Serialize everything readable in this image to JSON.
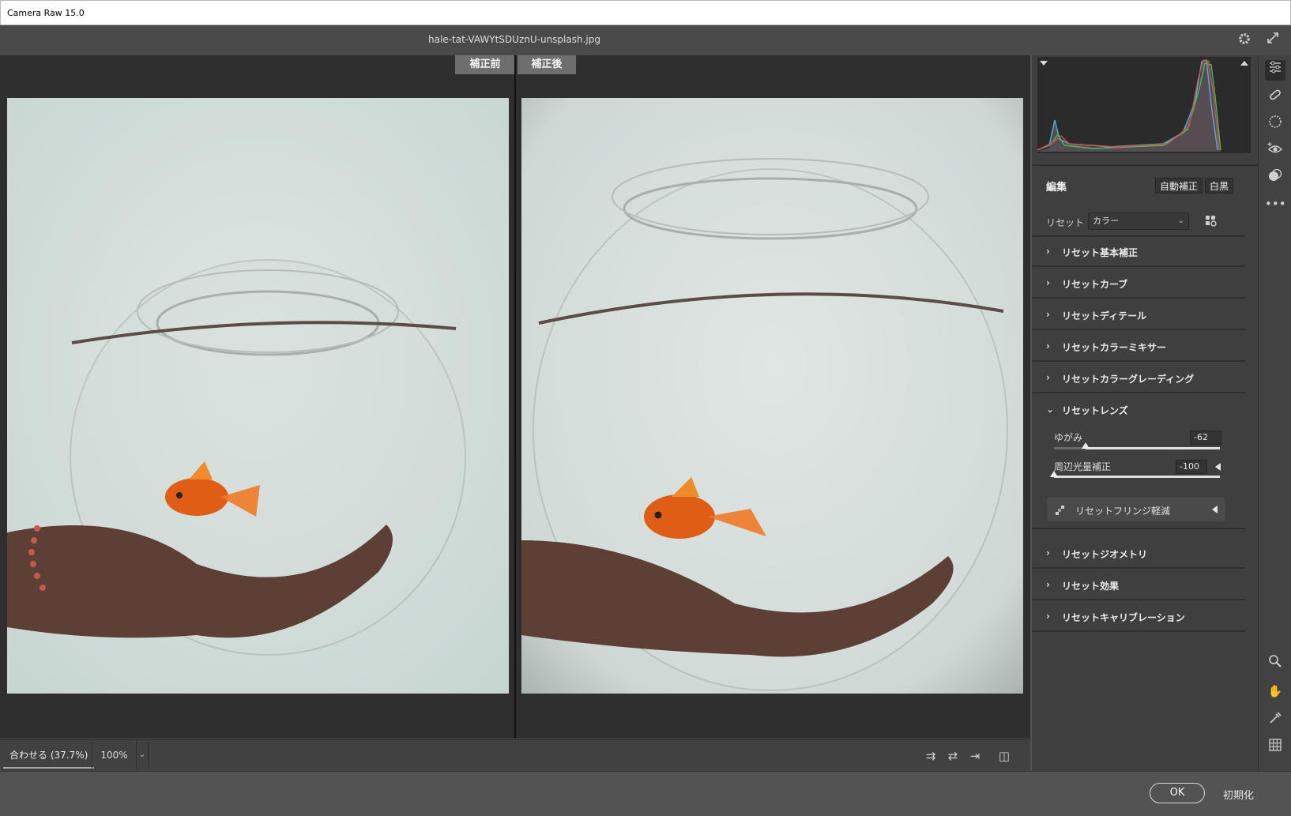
{
  "window": {
    "title": "Camera Raw 15.0"
  },
  "header": {
    "filename": "hale-tat-VAWYtSDUznU-unsplash.jpg",
    "icons": [
      "gear-icon",
      "fullscreen-icon"
    ]
  },
  "viewer": {
    "before_label": "補正前",
    "after_label": "補正後"
  },
  "statusbar": {
    "fit_label": "合わせる (37.7%)",
    "zoom_label": "100%",
    "icons": [
      "swap-before-after-icon",
      "swap-settings-icon",
      "copy-settings-icon",
      "toggle-view-icon"
    ]
  },
  "panel": {
    "edit_title": "編集",
    "auto_button": "自動補正",
    "bw_button": "白黒",
    "preset_label": "リセット",
    "preset_value": "カラー",
    "sections": [
      {
        "label": "リセット基本補正",
        "expanded": false
      },
      {
        "label": "リセットカーブ",
        "expanded": false
      },
      {
        "label": "リセットディテール",
        "expanded": false
      },
      {
        "label": "リセットカラーミキサー",
        "expanded": false
      },
      {
        "label": "リセットカラーグレーディング",
        "expanded": false
      },
      {
        "label": "リセットレンズ",
        "expanded": true
      },
      {
        "label": "リセットジオメトリ",
        "expanded": false
      },
      {
        "label": "リセット効果",
        "expanded": false
      },
      {
        "label": "リセットキャリブレーション",
        "expanded": false
      }
    ],
    "lens": {
      "distortion_label": "ゆがみ",
      "distortion_value": "-62",
      "distortion_level": 0.19,
      "vignette_label": "周辺光量補正",
      "vignette_value": "-100",
      "vignette_level": 0.0,
      "fringe_label": "リセットフリンジ軽減"
    }
  },
  "toolstrip": {
    "icons": [
      "edit-sliders-icon",
      "healing-brush-icon",
      "mask-icon",
      "red-eye-icon",
      "presets-icon",
      "more-icon",
      "zoom-icon",
      "hand-icon",
      "color-sampler-icon",
      "grid-overlay-icon"
    ]
  },
  "footer": {
    "ok_label": "OK",
    "reset_label": "初期化"
  },
  "colors": {
    "panel_bg": "#3f3f3f",
    "viewer_bg": "#2f2f2f",
    "accent": "#e0e0e0"
  }
}
